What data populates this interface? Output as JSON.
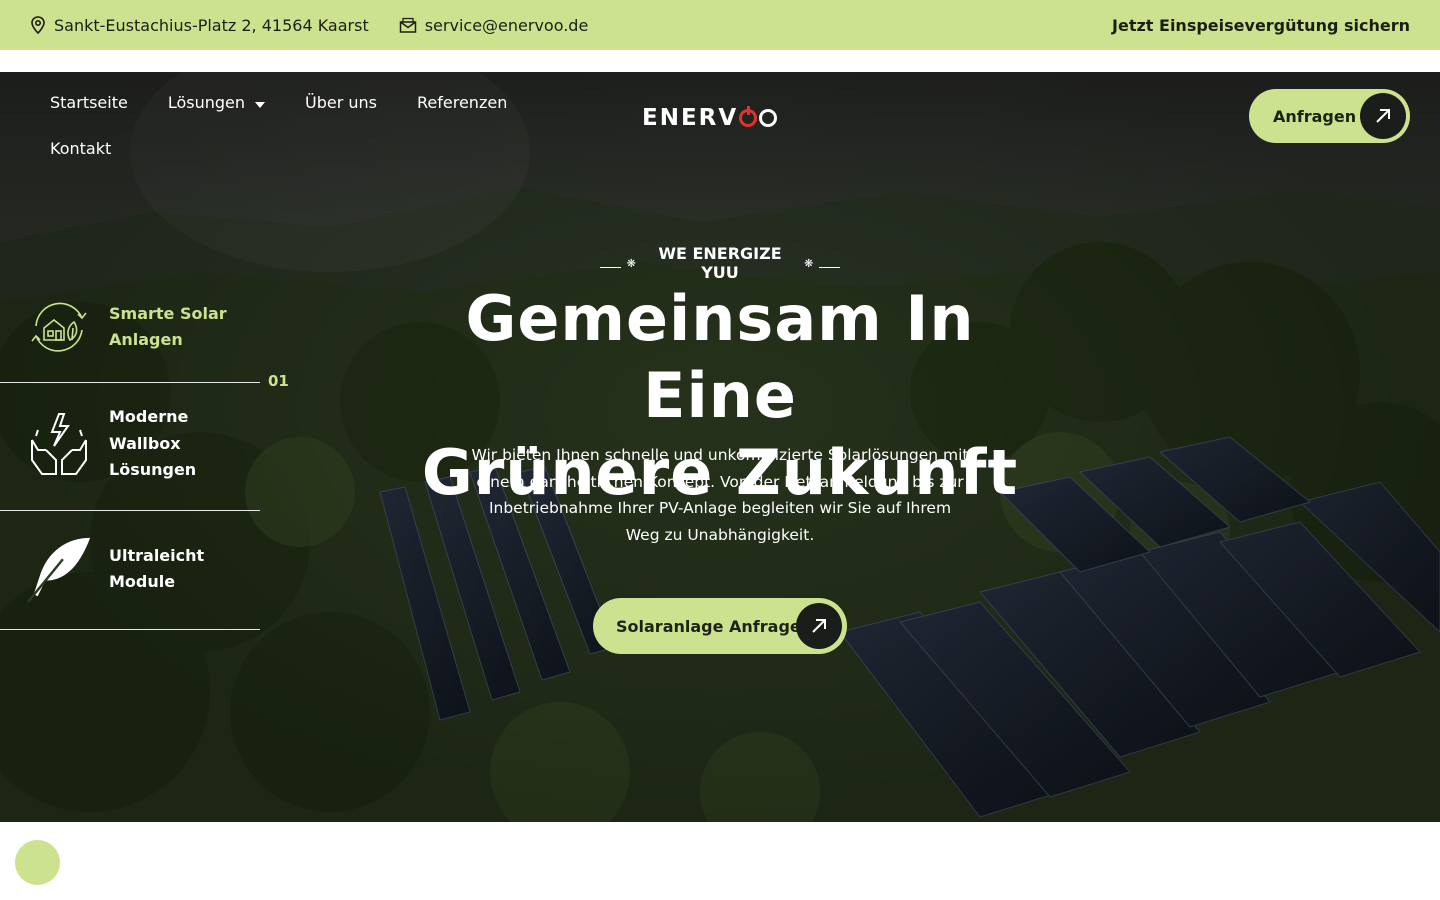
{
  "topbar": {
    "address": "Sankt-Eustachius-Platz 2, 41564 Kaarst",
    "email": "service@enervoo.de",
    "cta": "Jetzt Einspeisevergütung sichern"
  },
  "nav": {
    "items": [
      "Startseite",
      "Lösungen",
      "Über uns",
      "Referenzen",
      "Kontakt"
    ]
  },
  "logo": {
    "text_start": "ENERV",
    "alt": "ENERVOO"
  },
  "header": {
    "button_label": "Anfragen"
  },
  "hero": {
    "tagline": "WE ENERGIZE YUU",
    "headline_line1": "Gemeinsam In Eine",
    "headline_line2": "Grünere Zukunft",
    "lead": "Wir bieten Ihnen schnelle und unkomplizierte Solarlösungen mit einem ganzheitlichen Konzept. Von der Netzanmeldung bis zur Inbetriebnahme Ihrer PV-Anlage begleiten wir Sie auf Ihrem Weg zu Unabhängigkeit.",
    "button_label": "Solaranlage Anfragen"
  },
  "features": {
    "active_index": "01",
    "items": [
      {
        "line1": "Smarte Solar",
        "line2": "Anlagen",
        "line3": "",
        "icon": "smart-home-solar-icon"
      },
      {
        "line1": "Moderne",
        "line2": "Wallbox",
        "line3": "Lösungen",
        "icon": "hands-lightning-icon"
      },
      {
        "line1": "Ultraleicht",
        "line2": "Module",
        "line3": "",
        "icon": "feather-icon"
      }
    ]
  },
  "colors": {
    "accent": "#cde28f",
    "dark": "#1a1d1a",
    "logo_red": "#e3322b"
  }
}
